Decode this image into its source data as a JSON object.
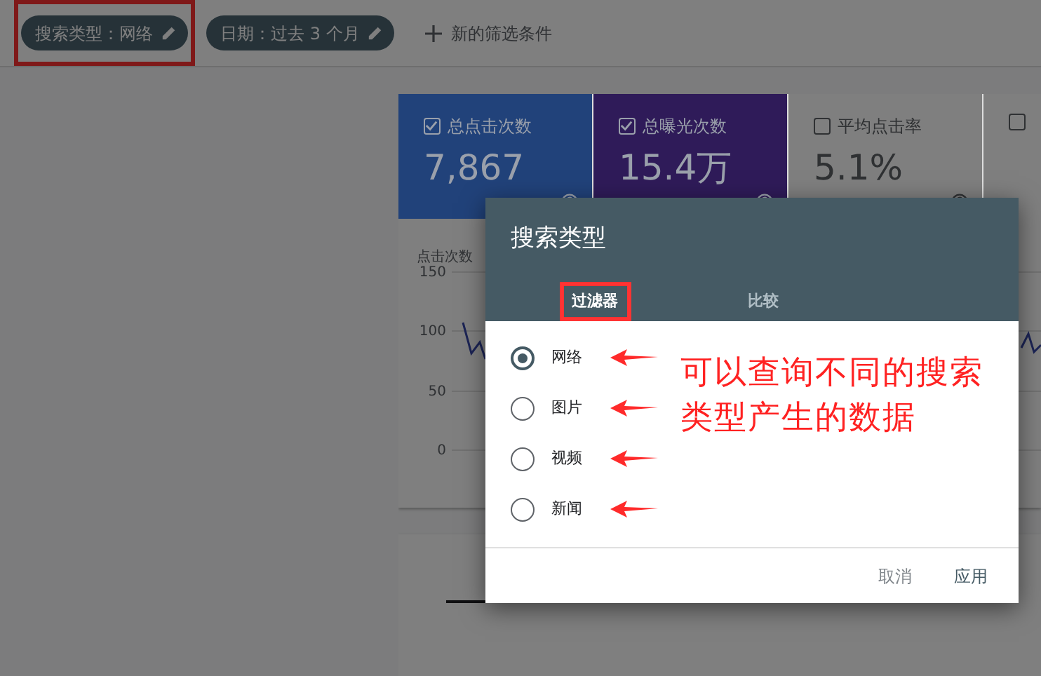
{
  "filter_bar": {
    "chips": [
      {
        "label": "搜索类型：网络",
        "highlighted": true
      },
      {
        "label": "日期：过去 3 个月",
        "highlighted": false
      }
    ],
    "add_filter": "新的筛选条件"
  },
  "metrics": [
    {
      "label": "总点击次数",
      "value": "7,867",
      "checked": true,
      "color": "#21427a"
    },
    {
      "label": "总曝光次数",
      "value": "15.4万",
      "checked": true,
      "color": "#2f1b59"
    },
    {
      "label": "平均点击率",
      "value": "5.1%",
      "checked": false,
      "color": "#7f7f7f"
    },
    {
      "checked": false,
      "color": "#7f7f7f"
    }
  ],
  "chart": {
    "ylabel": "点击次数",
    "yticks": [
      "150",
      "100",
      "50",
      "0"
    ]
  },
  "dialog": {
    "title": "搜索类型",
    "tabs": [
      {
        "label": "过滤器",
        "selected": true,
        "highlighted": true
      },
      {
        "label": "比较",
        "selected": false,
        "highlighted": false
      }
    ],
    "options": [
      {
        "label": "网络",
        "selected": true,
        "arrow": true
      },
      {
        "label": "图片",
        "selected": false,
        "arrow": true
      },
      {
        "label": "视频",
        "selected": false,
        "arrow": true
      },
      {
        "label": "新闻",
        "selected": false,
        "arrow": true
      }
    ],
    "buttons": [
      "取消",
      "应用"
    ]
  },
  "annotation": {
    "text": "可以查询不同的搜索类型产生的数据"
  }
}
